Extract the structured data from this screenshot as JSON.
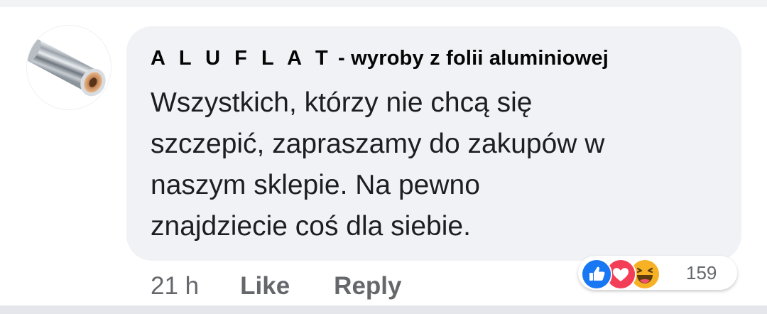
{
  "comment": {
    "author_name": "A L U F L A T",
    "author_suffix": "- wyroby z folii aluminiowej",
    "text_lines": [
      "Wszystkich, którzy nie chcą się",
      "szczepić, zapraszamy do zakupów w",
      "naszym sklepie. Na pewno",
      "znajdziecie coś dla siebie."
    ],
    "avatar_icon": "aluminum-foil-roll-icon"
  },
  "actions": {
    "time": "21 h",
    "like_label": "Like",
    "reply_label": "Reply"
  },
  "reactions": {
    "icons": [
      "like-reaction-icon",
      "love-reaction-icon",
      "haha-reaction-icon"
    ],
    "count": "159",
    "colors": {
      "like": "#1877f2",
      "love": "#f33e58",
      "haha": "#f7b125"
    }
  },
  "colors": {
    "bubble": "#f0f2f5",
    "secondary_text": "#65676b",
    "primary_text": "#050505"
  }
}
